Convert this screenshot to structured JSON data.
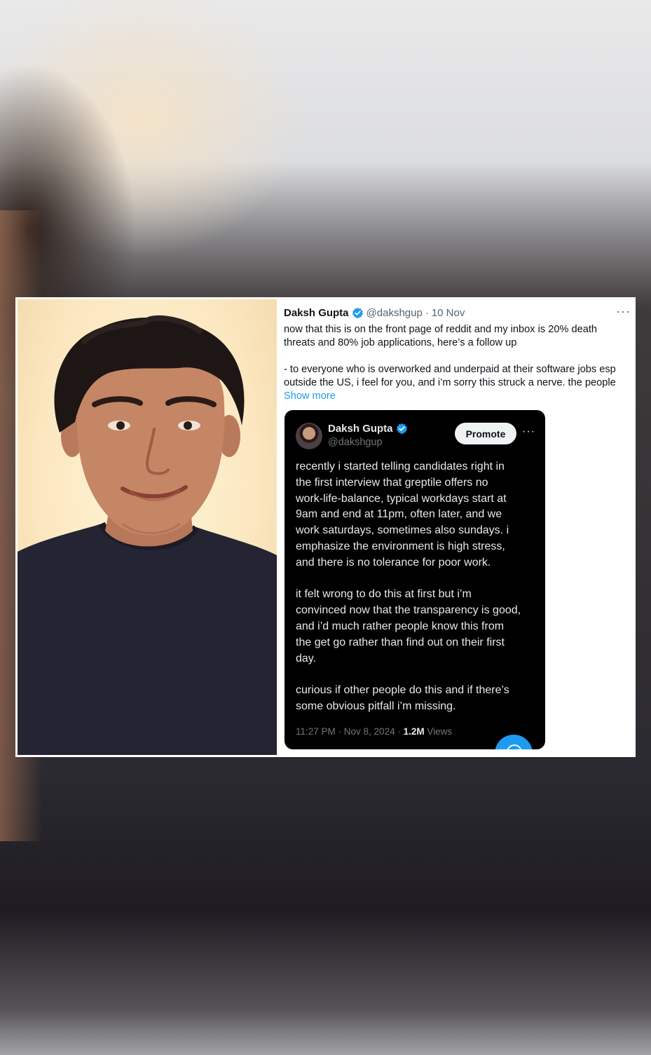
{
  "tweet": {
    "author_name": "Daksh Gupta",
    "handle": "@dakshgup",
    "separator": "·",
    "date": "10 Nov",
    "more_label": "···",
    "lines": [
      "now that this is on the front page of reddit and my inbox is 20% death",
      "threats and 80% job applications, here’s a follow up",
      "- to everyone who is overworked and underpaid at their software jobs esp",
      "outside the US, i feel for you, and i’m sorry this struck a nerve. the people"
    ],
    "show_more": "Show more"
  },
  "quoted": {
    "author_name": "Daksh Gupta",
    "handle": "@dakshgup",
    "promote_label": "Promote",
    "more_label": "···",
    "paragraph1": [
      "recently i started telling candidates right in",
      "the first interview that greptile offers no",
      "work-life-balance, typical workdays start at",
      "9am and end at 11pm, often later, and we",
      "work saturdays, sometimes also sundays. i",
      "emphasize the environment is high stress,",
      "and there is no tolerance for poor work."
    ],
    "paragraph2": [
      "it felt wrong to do this at first but i’m",
      "convinced now that the transparency is good,",
      "and i’d much rather people know this from",
      "the get go rather than find out on their first",
      "day."
    ],
    "paragraph3": [
      "curious if other people do this and if there’s",
      "some obvious pitfall i’m missing."
    ],
    "timestamp": "11:27 PM · Nov 8, 2024 · ",
    "views_count": "1.2M",
    "views_label": " Views"
  },
  "colors": {
    "accent": "#1d9bf0",
    "verified": "#1d9bf0",
    "dark_bg": "#000000"
  },
  "icons": {
    "verified": "verified-badge-icon",
    "more": "more-icon",
    "compose": "compose-icon"
  }
}
